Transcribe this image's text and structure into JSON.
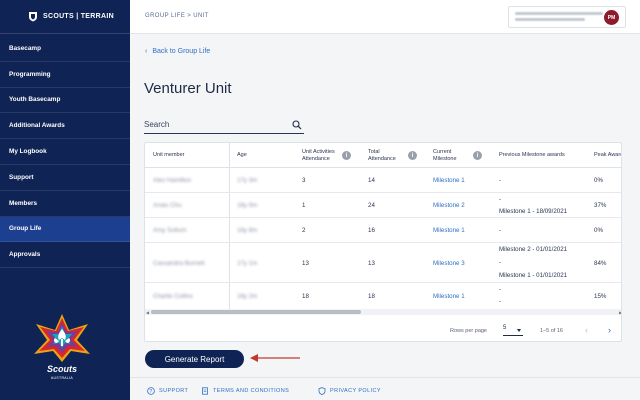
{
  "brand": {
    "name": "SCOUTS | TERRAIN"
  },
  "sidebar": {
    "items": [
      {
        "label": "Basecamp",
        "active": false
      },
      {
        "label": "Programming",
        "active": false
      },
      {
        "label": "Youth Basecamp",
        "active": false
      },
      {
        "label": "Additional Awards",
        "active": false
      },
      {
        "label": "My Logbook",
        "active": false
      },
      {
        "label": "Support",
        "active": false
      },
      {
        "label": "Members",
        "active": false
      },
      {
        "label": "Group Life",
        "active": true
      },
      {
        "label": "Approvals",
        "active": false
      }
    ],
    "logo_text": "Scouts",
    "logo_subtext": "AUSTRALIA"
  },
  "topbar": {
    "breadcrumb": "GROUP LIFE > UNIT",
    "avatar_initials": "PM"
  },
  "main": {
    "back_link": "Back to Group Life",
    "title": "Venturer Unit",
    "search_placeholder": "Search"
  },
  "table": {
    "headers": {
      "member": "Unit member",
      "age": "Age",
      "unit_activities": "Unit Activities Attendance",
      "total_attendance": "Total Attendance",
      "current_milestone": "Current Milestone",
      "previous_awards": "Previous Milestone awards",
      "peak_award": "Peak Award"
    },
    "rows": [
      {
        "member": "Alex Hamilton",
        "age": "17y 3m",
        "unit_activities": "3",
        "total_attendance": "14",
        "milestone": "Milestone 1",
        "prev_line1": "-",
        "prev_line2": "",
        "prev_line3": "",
        "peak": "0%"
      },
      {
        "member": "Anais Chu",
        "age": "16y 5m",
        "unit_activities": "1",
        "total_attendance": "24",
        "milestone": "Milestone 2",
        "prev_line1": "-",
        "prev_line2": "Milestone 1 - 18/09/2021",
        "prev_line3": "",
        "peak": "37%"
      },
      {
        "member": "Amy Sultum",
        "age": "16y 8m",
        "unit_activities": "2",
        "total_attendance": "16",
        "milestone": "Milestone 1",
        "prev_line1": "-",
        "prev_line2": "",
        "prev_line3": "",
        "peak": "0%"
      },
      {
        "member": "Cassandra Burnett",
        "age": "17y 1m",
        "unit_activities": "13",
        "total_attendance": "13",
        "milestone": "Milestone 3",
        "prev_line1": "Milestone 2 - 01/01/2021",
        "prev_line2": "-",
        "prev_line3": "Milestone 1 - 01/01/2021",
        "peak": "84%"
      },
      {
        "member": "Charlie Collins",
        "age": "16y 2m",
        "unit_activities": "18",
        "total_attendance": "18",
        "milestone": "Milestone 1",
        "prev_line1": "-",
        "prev_line2": "-",
        "prev_line3": "",
        "peak": "15%"
      }
    ],
    "pagination": {
      "rows_per_page_label": "Rows per page",
      "rows_per_page": "5",
      "range": "1–5 of 16"
    }
  },
  "actions": {
    "generate_report": "Generate Report"
  },
  "footer": {
    "support": "SUPPORT",
    "terms": "TERMS AND CONDITIONS",
    "privacy": "PRIVACY POLICY"
  },
  "colors": {
    "navy": "#0f2454",
    "active_nav": "#1d3f8f",
    "link": "#2f6fc4",
    "avatar": "#8c1c2b",
    "arrow": "#c0392b"
  }
}
